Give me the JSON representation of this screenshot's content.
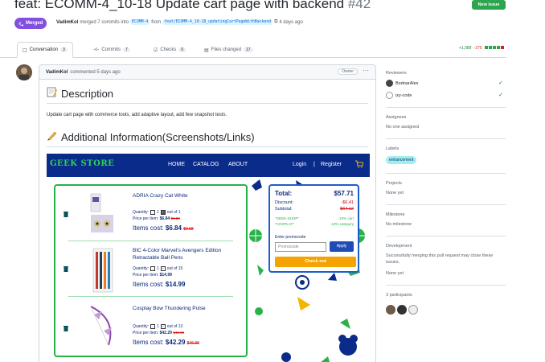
{
  "header": {
    "title": "feat: ECOMM-4_10-18 Update cart page with backend",
    "number": "#42",
    "new_issue_label": "New issue",
    "status": "Merged",
    "author": "VadimKol",
    "merge_text": "merged 7 commits into",
    "base_branch": "ECOMM-4",
    "from_text": "from",
    "head_branch": "feat/ECOMM-4_10-18_updatingCartPageWithBackend",
    "time": "4 days ago"
  },
  "tabs": [
    {
      "label": "Conversation",
      "count": "3"
    },
    {
      "label": "Commits",
      "count": "7"
    },
    {
      "label": "Checks",
      "count": "0"
    },
    {
      "label": "Files changed",
      "count": "17"
    }
  ],
  "diffstat": {
    "additions": "+1,089",
    "deletions": "−275"
  },
  "comment": {
    "author": "VadimKol",
    "meta": "commented 5 days ago",
    "owner_badge": "Owner",
    "heading_description": "Description",
    "description_text": "Update cart page with commerce tools, add adaptive layout, add few snapshot tests.",
    "heading_info": "Additional Information(Screenshots/Links)"
  },
  "shop": {
    "logo": "GEEK STORE",
    "nav": [
      "HOME",
      "CATALOG",
      "ABOUT"
    ],
    "login": "Login",
    "separator": "|",
    "register": "Register",
    "items": [
      {
        "name": "ADRIA Crazy Cat White",
        "quantity_label": "Quantity:",
        "qty": "1",
        "out_of": "out of 1",
        "price_label": "Price per item:",
        "price": "$6.84",
        "old_price": "$9.58",
        "cost_label": "Items cost:",
        "cost": "$6.84",
        "old_cost": "$9.58"
      },
      {
        "name": "BIC 4-Color Marvel's Avengers Edition Retractable Ball Pens",
        "quantity_label": "Quantity:",
        "qty": "1",
        "out_of": "out of 15",
        "price_label": "Price per item:",
        "price": "$14.99",
        "old_price": "",
        "cost_label": "Items cost:",
        "cost": "$14.99",
        "old_cost": ""
      },
      {
        "name": "Cosplay Bow Thundering Pulse",
        "quantity_label": "Quantity:",
        "qty": "1",
        "out_of": "out of 13",
        "price_label": "Price per item:",
        "price": "$42.29",
        "old_price": "$46.99",
        "cost_label": "Items cost:",
        "cost": "$42.29",
        "old_cost": "$46.99"
      }
    ],
    "summary": {
      "total_label": "Total:",
      "total": "$57.71",
      "discount_label": "Discount:",
      "discount": "-$6.41",
      "subtotal_label": "Subtotal:",
      "subtotal": "$64.12",
      "code1": "\"GEEK-SHOP\"",
      "code1_value": "-10% cart",
      "code2": "\"COSPLAY\"",
      "code2_value": "-10% category",
      "promo_label": "Enter promocode",
      "promo_placeholder": "Promocode",
      "apply": "Apply",
      "checkout": "Check out"
    }
  },
  "sidebar": {
    "reviewers_title": "Reviewers",
    "reviewers": [
      "BodnarAlex",
      "izy-code"
    ],
    "assignees_title": "Assignees",
    "assignees_text": "No one assigned",
    "labels_title": "Labels",
    "label": "enhancement",
    "projects_title": "Projects",
    "projects_text": "None yet",
    "milestone_title": "Milestone",
    "milestone_text": "No milestone",
    "development_title": "Development",
    "development_text": "Successfully merging this pull request may close these issues.",
    "development_none": "None yet",
    "participants_title": "3 participants"
  },
  "colors": {
    "merged": "#8250df",
    "new_issue": "#2da44e",
    "shop_nav": "#0a2b8a",
    "shop_green": "#27b348",
    "checkout": "#f4a300"
  }
}
